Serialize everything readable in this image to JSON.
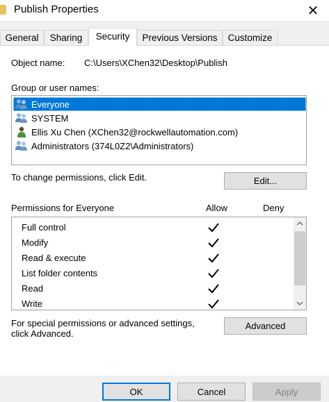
{
  "window": {
    "title": "Publish Properties",
    "close_glyph": "✕"
  },
  "tabs": [
    {
      "label": "General"
    },
    {
      "label": "Sharing"
    },
    {
      "label": "Security"
    },
    {
      "label": "Previous Versions"
    },
    {
      "label": "Customize"
    }
  ],
  "security": {
    "object_name_label": "Object name:",
    "object_name_value": "C:\\Users\\XChen32\\Desktop\\Publish",
    "group_label": "Group or user names:",
    "users": [
      {
        "name": "Everyone",
        "icon": "users-group-icon"
      },
      {
        "name": "SYSTEM",
        "icon": "users-group-icon"
      },
      {
        "name": "Ellis Xu Chen (XChen32@rockwellautomation.com)",
        "icon": "user-icon"
      },
      {
        "name": "Administrators (374L0Z2\\Administrators)",
        "icon": "users-group-icon"
      }
    ],
    "change_hint": "To change permissions, click Edit.",
    "edit_label": "Edit...",
    "permissions_header": "Permissions for Everyone",
    "allow_header": "Allow",
    "deny_header": "Deny",
    "permissions": [
      {
        "name": "Full control",
        "allow": true,
        "deny": false
      },
      {
        "name": "Modify",
        "allow": true,
        "deny": false
      },
      {
        "name": "Read & execute",
        "allow": true,
        "deny": false
      },
      {
        "name": "List folder contents",
        "allow": true,
        "deny": false
      },
      {
        "name": "Read",
        "allow": true,
        "deny": false
      },
      {
        "name": "Write",
        "allow": true,
        "deny": false
      }
    ],
    "special_line1": "For special permissions or advanced settings,",
    "special_line2": "click Advanced.",
    "advanced_label": "Advanced"
  },
  "footer": {
    "ok_label": "OK",
    "cancel_label": "Cancel",
    "apply_label": "Apply"
  },
  "colors": {
    "selection": "#0078d7",
    "folder": "#e8c25a"
  }
}
